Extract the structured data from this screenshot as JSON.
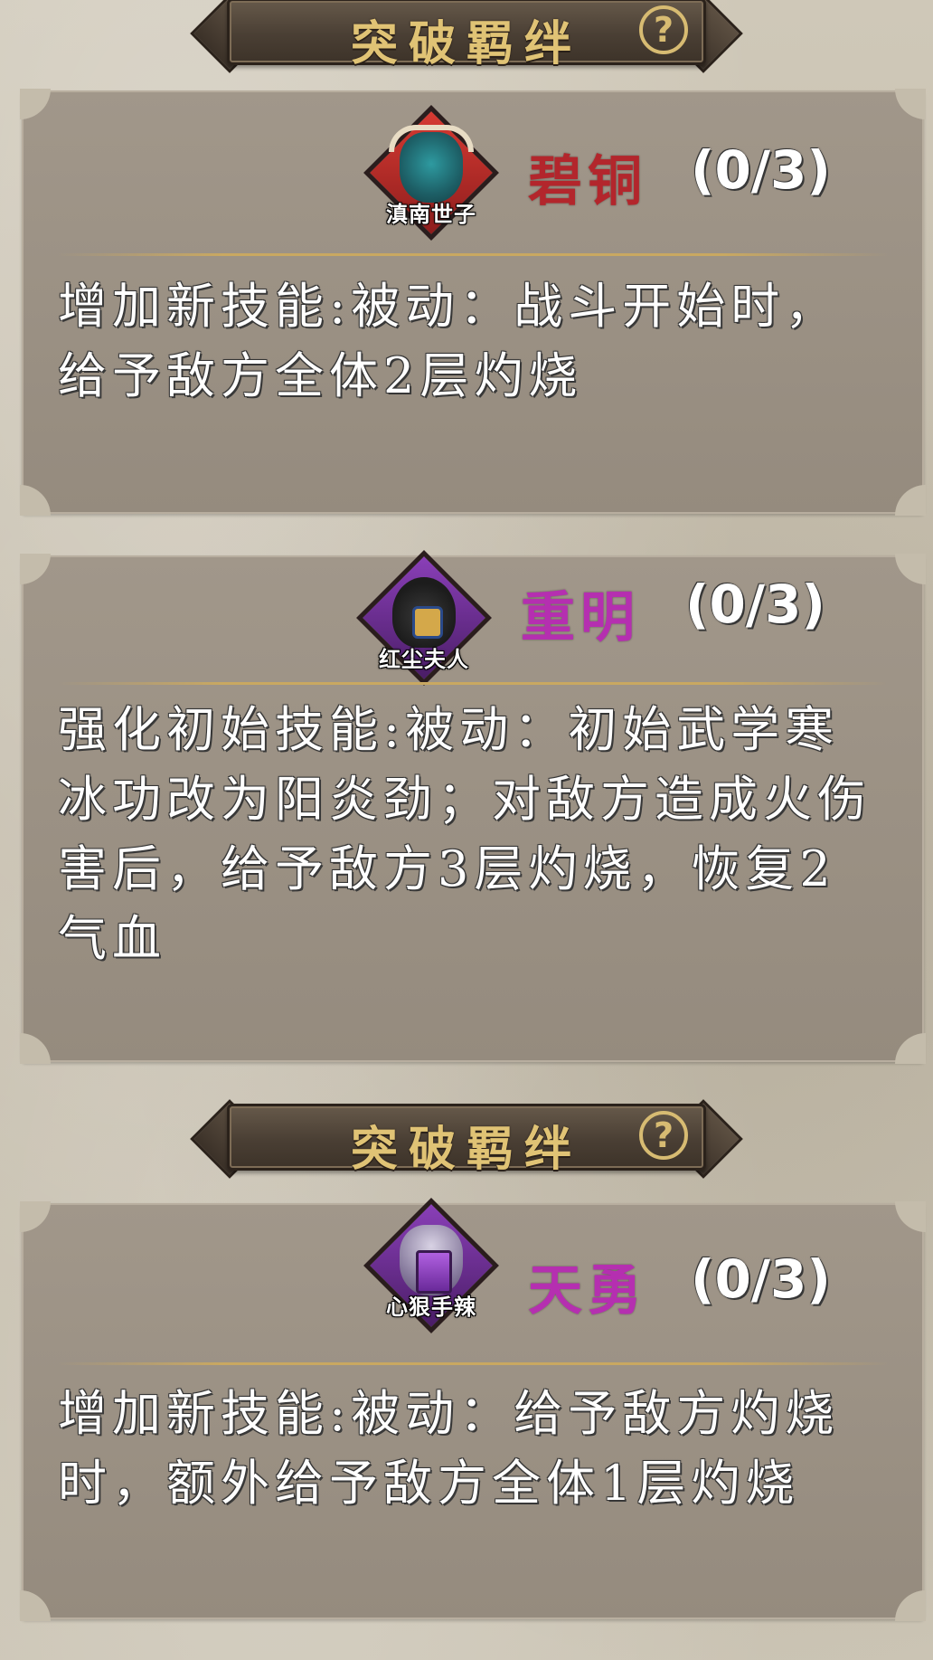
{
  "sections": [
    {
      "banner_title": "突破羁绊",
      "help_icon": "?",
      "cards": [
        {
          "portrait_tag": "滇南世子",
          "rank": "碧铜",
          "rank_color": "#b3262c",
          "frame_color": "#c8262c",
          "progress": "(0/3)",
          "description": "增加新技能:被动：战斗开始时，给予敌方全体2层灼烧"
        },
        {
          "portrait_tag": "红尘夫人",
          "rank": "重明",
          "rank_color": "#b52fb0",
          "frame_color": "#6b2a8c",
          "progress": "(0/3)",
          "description": "强化初始技能:被动：初始武学寒冰功改为阳炎劲；对敌方造成火伤害后，给予敌方3层灼烧，恢复2气血"
        }
      ]
    },
    {
      "banner_title": "突破羁绊",
      "help_icon": "?",
      "cards": [
        {
          "portrait_tag": "心狠手辣",
          "rank": "天勇",
          "rank_color": "#b52fb0",
          "frame_color": "#6b2a8c",
          "progress": "(0/3)",
          "description": "增加新技能:被动：给予敌方灼烧时，额外给予敌方全体1层灼烧"
        }
      ]
    }
  ]
}
